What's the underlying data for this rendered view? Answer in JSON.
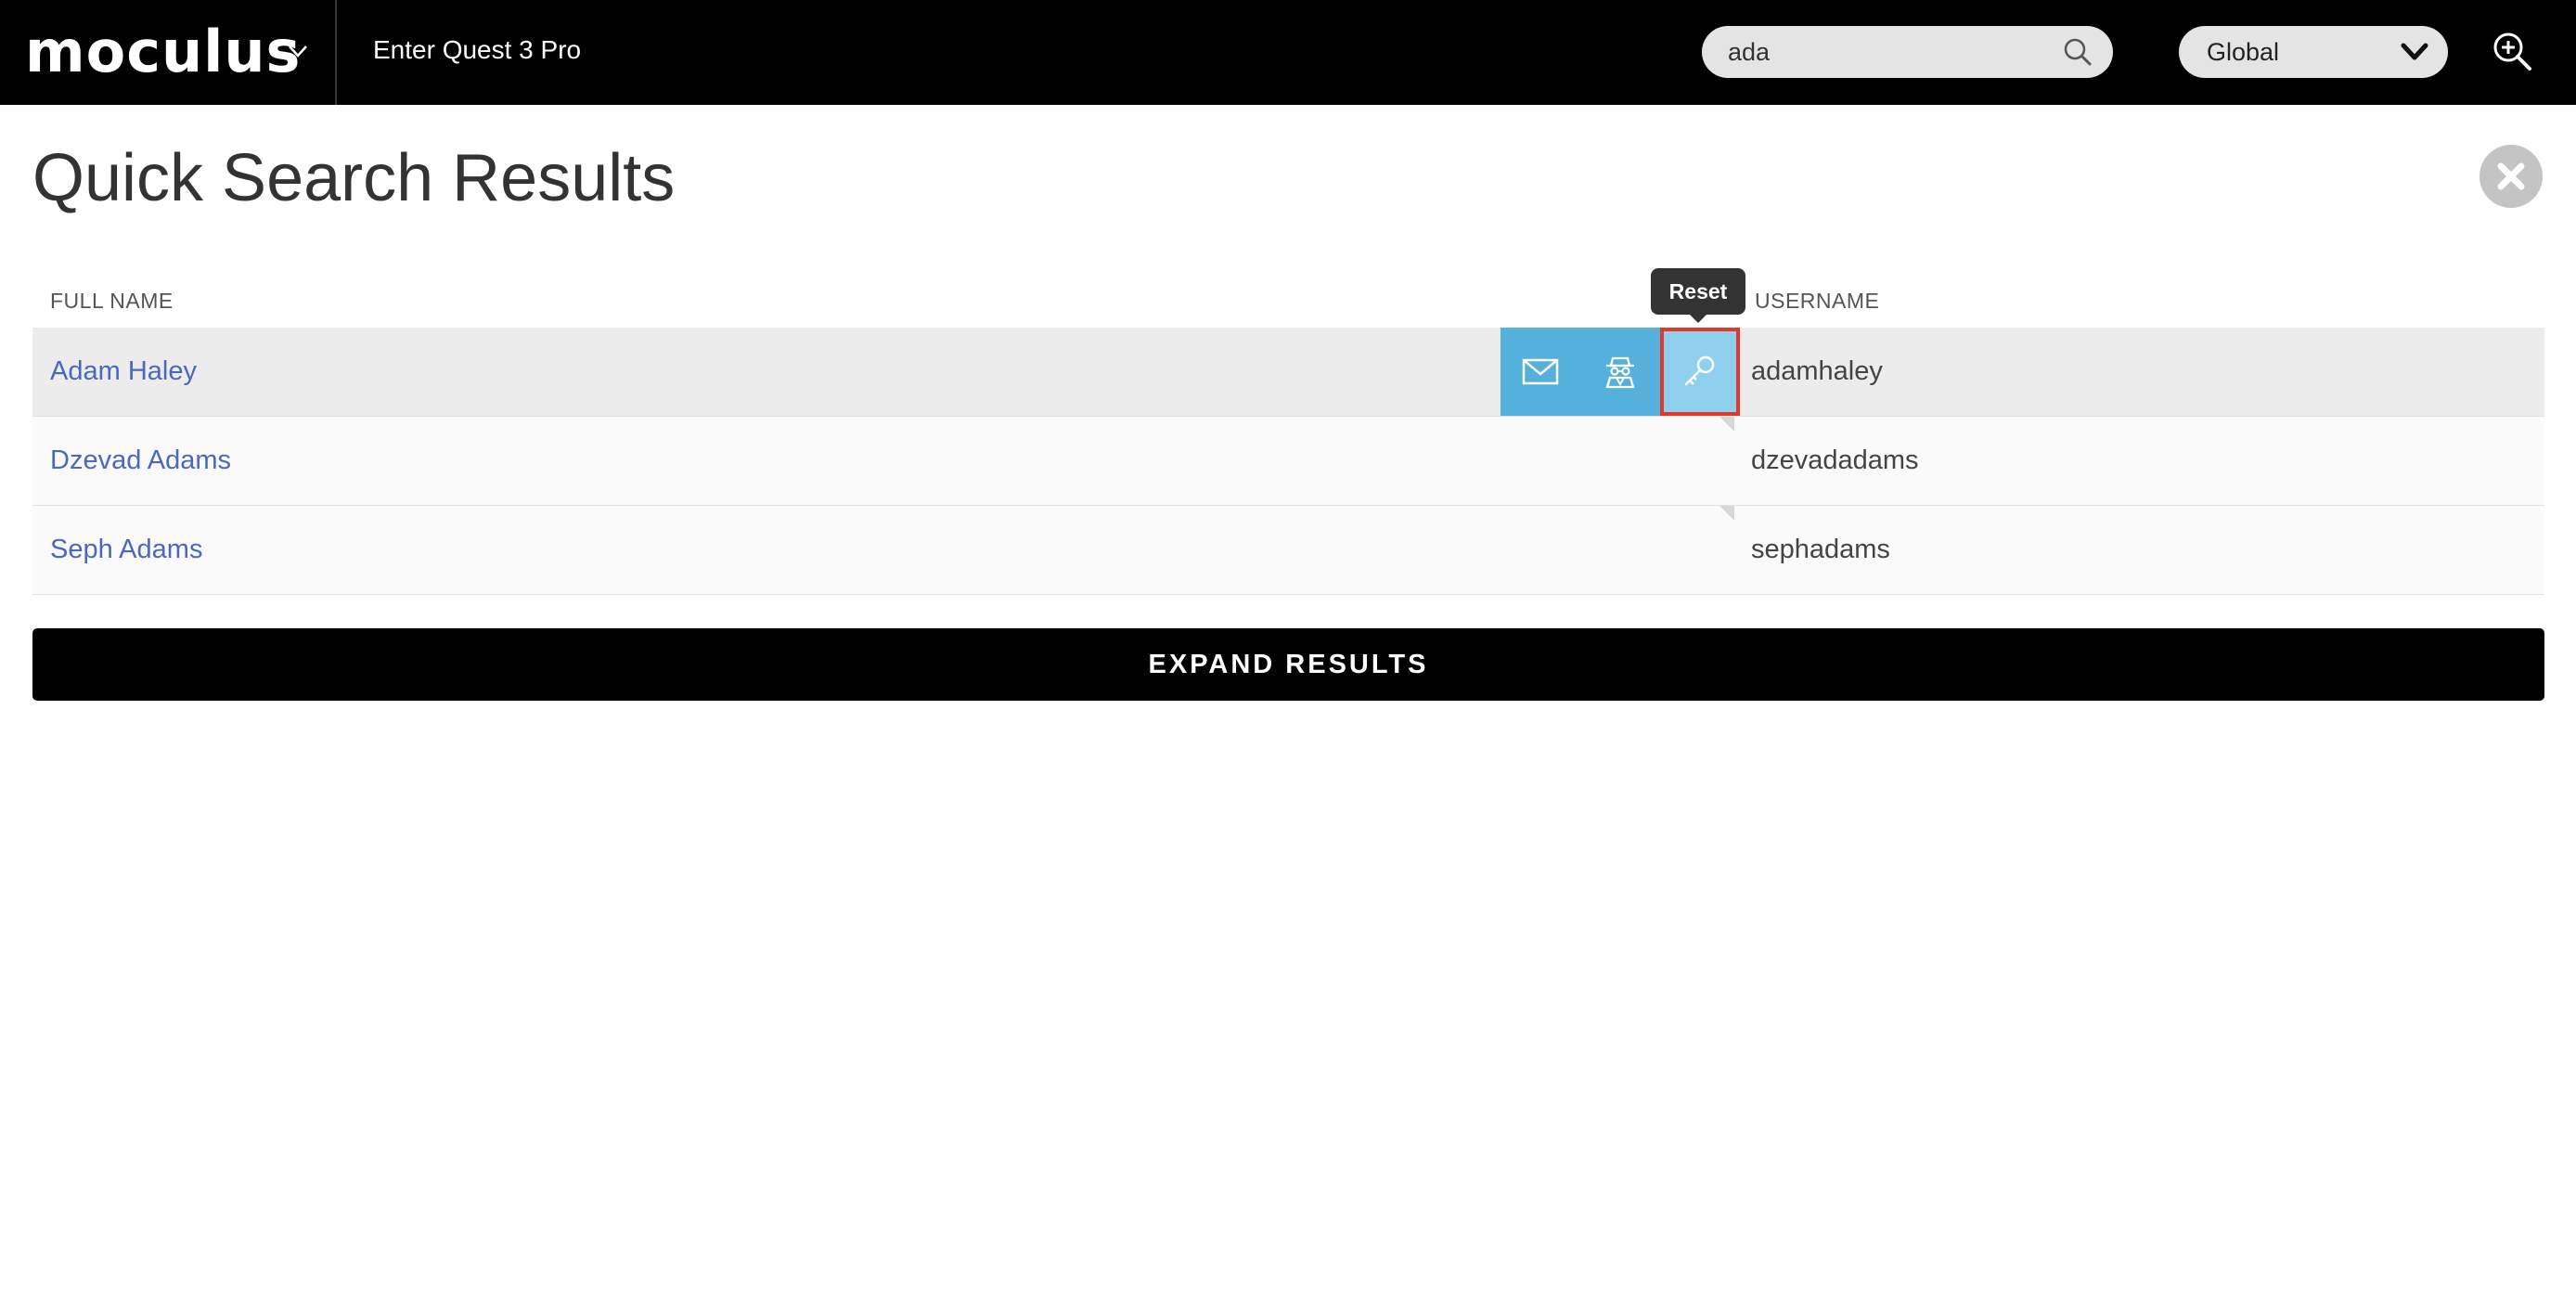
{
  "header": {
    "logo": "moculus",
    "product": "Enter Quest 3 Pro",
    "search": {
      "value": "ada",
      "placeholder": ""
    },
    "scope": {
      "selected": "Global"
    }
  },
  "main": {
    "title": "Quick Search Results",
    "columns": {
      "full_name": "FULL NAME",
      "username": "USERNAME"
    },
    "rows": [
      {
        "full_name": "Adam Haley",
        "username": "adamhaley"
      },
      {
        "full_name": "Dzevad Adams",
        "username": "dzevadadams"
      },
      {
        "full_name": "Seph Adams",
        "username": "sephadams"
      }
    ],
    "tooltip": "Reset",
    "expand_label": "EXPAND RESULTS"
  },
  "icons": {
    "logo_chevron": "chevron-down-icon",
    "search": "search-icon",
    "scope_chevron": "chevron-down-icon",
    "zoom": "zoom-in-icon",
    "close": "close-icon",
    "email": "envelope-icon",
    "impersonate": "spy-icon",
    "reset": "key-icon"
  },
  "colors": {
    "topbar": "#000000",
    "link": "#4a68c0",
    "action": "#55b0dc",
    "action_active": "#8fd0ee",
    "highlight": "#e0392b"
  }
}
